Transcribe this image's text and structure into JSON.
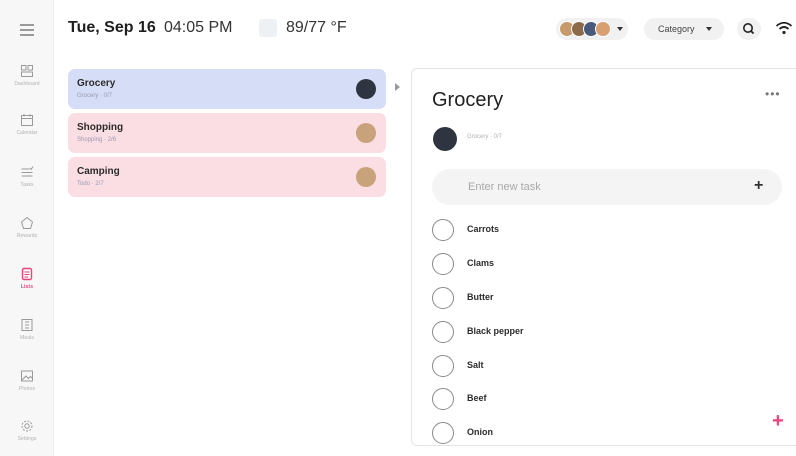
{
  "nav": {
    "items": [
      {
        "label": "Dashboard",
        "icon": "dashboard-icon"
      },
      {
        "label": "Calendar",
        "icon": "calendar-icon"
      },
      {
        "label": "Tasks",
        "icon": "tasks-icon"
      },
      {
        "label": "Rewards",
        "icon": "rewards-icon"
      },
      {
        "label": "Lists",
        "icon": "lists-icon",
        "active": true
      },
      {
        "label": "Meals",
        "icon": "meals-icon"
      },
      {
        "label": "Photos",
        "icon": "photos-icon"
      },
      {
        "label": "Settings",
        "icon": "settings-icon"
      }
    ]
  },
  "header": {
    "date": "Tue, Sep 16",
    "time": "04:05 PM",
    "temperature": "89/77 °F",
    "category_label": "Category"
  },
  "lists": [
    {
      "title": "Grocery",
      "subtitle": "Grocery · 0/7",
      "color": "#d5def6",
      "selected": true
    },
    {
      "title": "Shopping",
      "subtitle": "Shopping · 2/6",
      "color": "#fbdde4"
    },
    {
      "title": "Camping",
      "subtitle": "Todo · 2/7",
      "color": "#fbdde4"
    }
  ],
  "detail": {
    "title": "Grocery",
    "meta": "Grocery · 0/7",
    "new_task_placeholder": "Enter new task",
    "tasks": [
      "Carrots",
      "Clams",
      "Butter",
      "Black pepper",
      "Salt",
      "Beef",
      "Onion"
    ]
  },
  "colors": {
    "accent": "#e8457a",
    "card_blue": "#d5def6",
    "card_pink": "#fbdde4"
  }
}
